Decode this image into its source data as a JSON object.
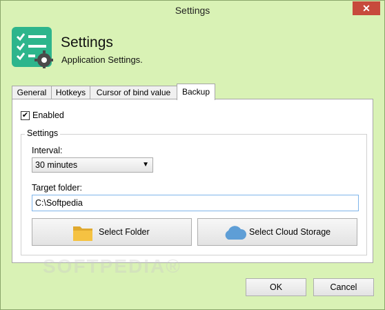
{
  "window": {
    "title": "Settings",
    "close_glyph": "✕"
  },
  "header": {
    "title": "Settings",
    "subtitle": "Application Settings.",
    "icon": "checklist-gear-icon"
  },
  "tabs": [
    {
      "label": "General"
    },
    {
      "label": "Hotkeys"
    },
    {
      "label": "Cursor of bind value"
    },
    {
      "label": "Backup",
      "active": true
    }
  ],
  "backup": {
    "enabled_label": "Enabled",
    "enabled_checked": true,
    "check_glyph": "✔",
    "group_label": "Settings",
    "interval_label": "Interval:",
    "interval_value": "30 minutes",
    "dropdown_glyph": "▼",
    "target_label": "Target folder:",
    "target_value": "C:\\Softpedia",
    "select_folder_label": "Select Folder",
    "select_cloud_label": "Select Cloud Storage"
  },
  "watermark": "SOFTPEDIA®",
  "footer": {
    "ok_label": "OK",
    "cancel_label": "Cancel"
  },
  "colors": {
    "accent": "#d9f2b5",
    "icon_teal": "#2db58c",
    "close_red": "#c74a3c",
    "folder_yellow": "#f5c242",
    "cloud_blue": "#5e9ed6"
  }
}
